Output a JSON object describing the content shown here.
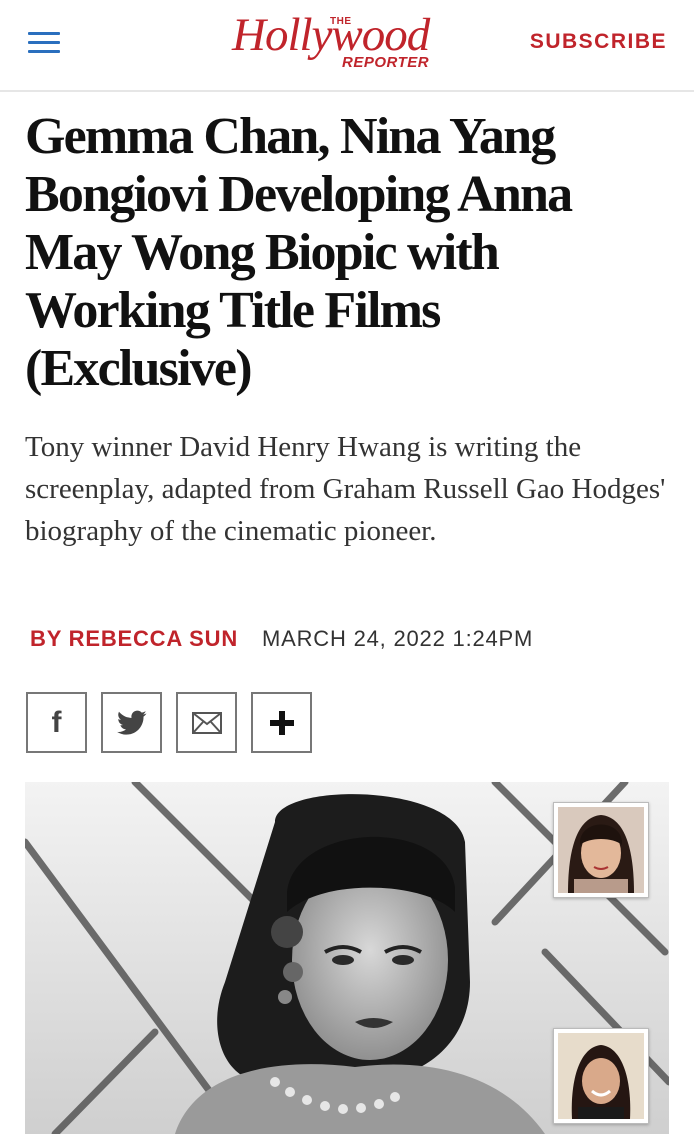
{
  "header": {
    "logo": {
      "the": "THE",
      "main": "Hollywood",
      "sub": "REPORTER"
    },
    "subscribe_label": "SUBSCRIBE"
  },
  "article": {
    "headline": "Gemma Chan, Nina Yang Bongiovi Developing Anna May Wong Biopic with Working Title Films (Exclusive)",
    "dek": "Tony winner David Henry Hwang is writing the screenplay, adapted from Graham Russell Gao Hodges' biography of the cinematic pioneer.",
    "author": "BY REBECCA SUN",
    "date": "MARCH 24, 2022 1:24PM"
  },
  "share": [
    {
      "icon": "facebook-icon"
    },
    {
      "icon": "twitter-icon"
    },
    {
      "icon": "email-icon"
    },
    {
      "icon": "plus-icon"
    }
  ],
  "colors": {
    "brand_red": "#c0242b",
    "menu_blue": "#2a6fbe"
  }
}
